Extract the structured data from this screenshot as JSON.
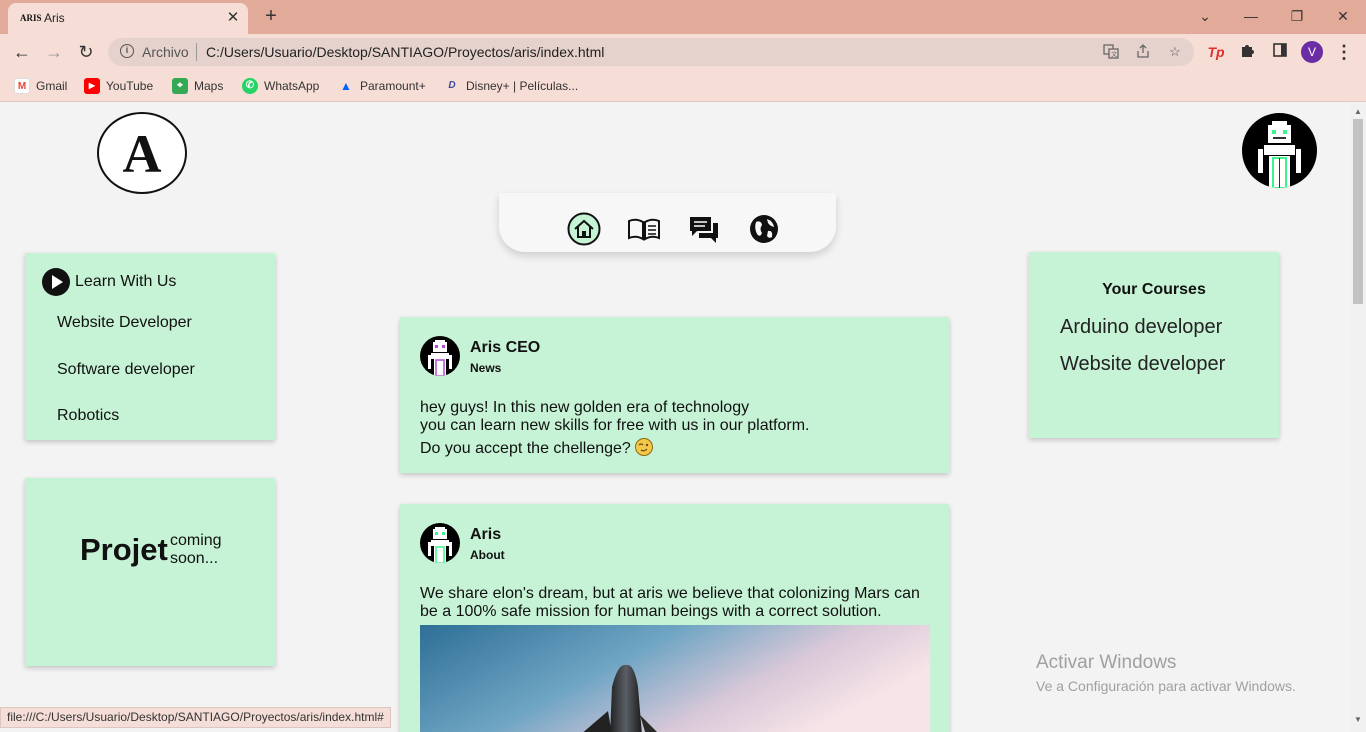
{
  "browser": {
    "tab": {
      "favicon_text": "ARIS",
      "title": "Aris",
      "close": "✕"
    },
    "newtab": "+",
    "window_controls": {
      "chevron": "⌄",
      "minimize": "—",
      "restore": "❐",
      "close": "✕"
    },
    "nav": {
      "back": "←",
      "forward": "→",
      "reload": "↻"
    },
    "omnibox": {
      "scheme": "Archivo",
      "url": "C:/Users/Usuario/Desktop/SANTIAGO/Proyectos/aris/index.html"
    },
    "profile_initial": "V",
    "menu": "⋮",
    "extension_tp": "Tp",
    "bookmarks": [
      {
        "label": "Gmail",
        "icon": "gmail-icon",
        "color": "#ea4335",
        "glyph": "M"
      },
      {
        "label": "YouTube",
        "icon": "youtube-icon",
        "color": "#ff0000",
        "glyph": "▶"
      },
      {
        "label": "Maps",
        "icon": "maps-icon",
        "color": "#34a853",
        "glyph": "⌖"
      },
      {
        "label": "WhatsApp",
        "icon": "whatsapp-icon",
        "color": "#25d366",
        "glyph": "✆"
      },
      {
        "label": "Paramount+",
        "icon": "paramount-icon",
        "color": "#0064ff",
        "glyph": "▲"
      },
      {
        "label": "Disney+ | Películas...",
        "icon": "disney-icon",
        "color": "#3b4aa3",
        "glyph": "D"
      }
    ],
    "status_url": "file:///C:/Users/Usuario/Desktop/SANTIAGO/Proyectos/aris/index.html#"
  },
  "page": {
    "logo_letter": "A",
    "nav_icons": [
      "home-icon",
      "book-icon",
      "chat-icon",
      "globe-icon"
    ],
    "learn": {
      "title": "Learn With Us",
      "items": [
        "Website Developer",
        "Software developer",
        "Robotics"
      ]
    },
    "project": {
      "big": "Projet",
      "small_line1": "coming",
      "small_line2": "soon..."
    },
    "courses": {
      "title": "Your Courses",
      "items": [
        "Arduino developer",
        "Website developer"
      ]
    },
    "posts": [
      {
        "author": "Aris CEO",
        "tag": "News",
        "line1": "hey guys! In this new golden era of technology",
        "line2": "you can learn new skills for free with us in our platform.",
        "line3": "Do you accept the chellenge?"
      },
      {
        "author": "Aris",
        "tag": "About",
        "text": "We share elon's dream, but at aris we believe that colonizing Mars can be a 100% safe mission for human beings with a correct solution."
      }
    ],
    "activate": {
      "title": "Activar Windows",
      "subtitle": "Ve a Configuración para activar Windows."
    }
  },
  "colors": {
    "card_bg": "#c6f3d5",
    "tab_strip": "#e2aa98",
    "toolbar": "#f6ded6",
    "robot_accent": "#3cf58a"
  }
}
